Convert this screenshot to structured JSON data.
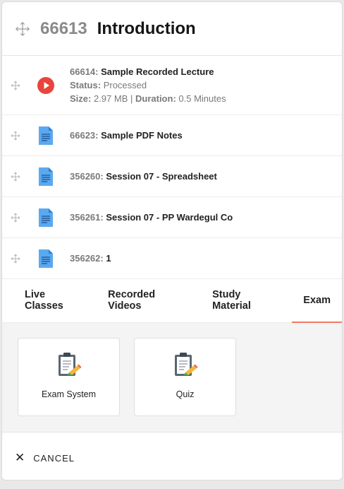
{
  "header": {
    "id": "66613",
    "title": "Introduction"
  },
  "items": [
    {
      "num": "66614:",
      "name": "Sample Recorded Lecture",
      "icon": "video-play-icon",
      "status_label": "Status:",
      "status_value": "Processed",
      "size_label": "Size:",
      "size_value": "2.97 MB |",
      "duration_label": "Duration:",
      "duration_value": "0.5 Minutes"
    },
    {
      "num": "66623:",
      "name": "Sample PDF Notes",
      "icon": "document-icon"
    },
    {
      "num": "356260:",
      "name": "Session 07 - Spreadsheet",
      "icon": "document-icon"
    },
    {
      "num": "356261:",
      "name": "Session 07 - PP Wardegul Co",
      "icon": "document-icon"
    },
    {
      "num": "356262:",
      "name": "1",
      "icon": "document-icon"
    }
  ],
  "tabs": [
    "Live Classes",
    "Recorded Videos",
    "Study Material",
    "Exam"
  ],
  "active_tab": "Exam",
  "tiles": [
    {
      "label": "Exam System",
      "icon": "clipboard-edit-icon"
    },
    {
      "label": "Quiz",
      "icon": "clipboard-edit-icon"
    }
  ],
  "footer": {
    "cancel": "CANCEL"
  },
  "colors": {
    "accent": "#f07a64",
    "play": "#e8453c",
    "doc": "#5aa9f0"
  }
}
